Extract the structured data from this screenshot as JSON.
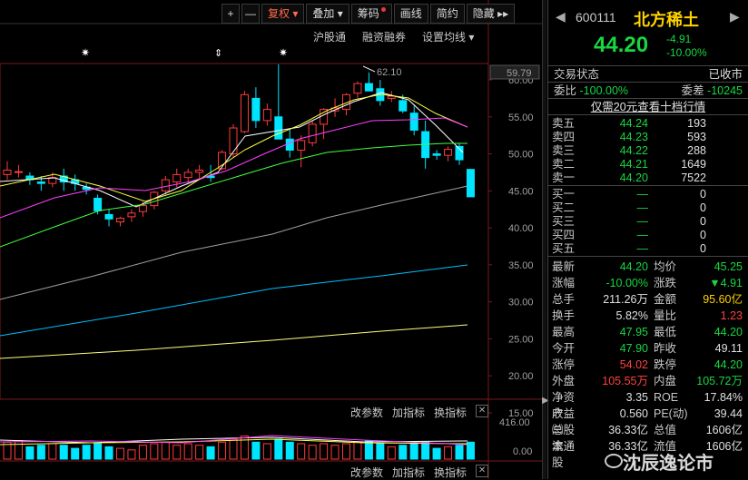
{
  "toolbar": {
    "plus": "+",
    "minus": "—",
    "restore": "复权",
    "overlay": "叠加",
    "chips": "筹码",
    "draw": "画线",
    "simple": "简约",
    "hide": "隐藏",
    "more": "▸▸"
  },
  "subbar": {
    "hk_connect": "沪股通",
    "margin": "融资融券",
    "ma_settings": "设置均线"
  },
  "chart": {
    "y_ticks": [
      "60.00",
      "55.00",
      "50.00",
      "45.00",
      "40.00",
      "35.00",
      "30.00",
      "25.00",
      "20.00",
      "15.00"
    ],
    "current_price_tag": "59.79",
    "high_marker": "62.10",
    "vol_ticks": [
      "416.00",
      "0.00"
    ],
    "colors": {
      "up": "#ff3b3b",
      "down": "#00e5ff",
      "ma5": "#ffffff",
      "ma10": "#ffff40",
      "ma20": "#ff40ff",
      "ma30": "#40ff40",
      "ma60": "#a0a0a0",
      "ma120": "#00c0ff",
      "ma250": "#ffff80"
    }
  },
  "indicator_bar": {
    "params": "改参数",
    "add": "加指标",
    "change": "换指标",
    "close": "✕"
  },
  "quote": {
    "code": "600111",
    "name": "北方稀土",
    "price": "44.20",
    "change": "-4.91",
    "change_pct": "-10.00%",
    "trade_status_label": "交易状态",
    "trade_status": "已收市",
    "ratio_label": "委比",
    "ratio": "-100.00%",
    "diff_label": "委差",
    "diff": "-10245",
    "promo": "仅需20元查看十档行情",
    "asks": [
      {
        "label": "卖五",
        "price": "44.24",
        "vol": "193"
      },
      {
        "label": "卖四",
        "price": "44.23",
        "vol": "593"
      },
      {
        "label": "卖三",
        "price": "44.22",
        "vol": "288"
      },
      {
        "label": "卖二",
        "price": "44.21",
        "vol": "1649"
      },
      {
        "label": "卖一",
        "price": "44.20",
        "vol": "7522"
      }
    ],
    "bids": [
      {
        "label": "买一",
        "price": "—",
        "vol": "0"
      },
      {
        "label": "买二",
        "price": "—",
        "vol": "0"
      },
      {
        "label": "买三",
        "price": "—",
        "vol": "0"
      },
      {
        "label": "买四",
        "price": "—",
        "vol": "0"
      },
      {
        "label": "买五",
        "price": "—",
        "vol": "0"
      }
    ],
    "stats": [
      {
        "l1": "最新",
        "v1": "44.20",
        "c1": "green",
        "l2": "均价",
        "v2": "45.25",
        "c2": "green"
      },
      {
        "l1": "涨幅",
        "v1": "-10.00%",
        "c1": "green",
        "l2": "涨跌",
        "v2": "▼4.91",
        "c2": "green"
      },
      {
        "l1": "总手",
        "v1": "211.26万",
        "c1": "white",
        "l2": "金额",
        "v2": "95.60亿",
        "c2": "yellow"
      },
      {
        "l1": "换手",
        "v1": "5.82%",
        "c1": "white",
        "l2": "量比",
        "v2": "1.23",
        "c2": "red"
      },
      {
        "l1": "最高",
        "v1": "47.95",
        "c1": "green",
        "l2": "最低",
        "v2": "44.20",
        "c2": "green"
      },
      {
        "l1": "今开",
        "v1": "47.90",
        "c1": "green",
        "l2": "昨收",
        "v2": "49.11",
        "c2": "white"
      },
      {
        "l1": "涨停",
        "v1": "54.02",
        "c1": "red",
        "l2": "跌停",
        "v2": "44.20",
        "c2": "green"
      },
      {
        "l1": "外盘",
        "v1": "105.55万",
        "c1": "red",
        "l2": "内盘",
        "v2": "105.72万",
        "c2": "green"
      },
      {
        "l1": "净资产",
        "v1": "3.35",
        "c1": "white",
        "l2": "ROE",
        "v2": "17.84%",
        "c2": "white"
      },
      {
        "l1": "收益㈢",
        "v1": "0.560",
        "c1": "white",
        "l2": "PE(动)",
        "v2": "39.44",
        "c2": "white"
      },
      {
        "l1": "总股本",
        "v1": "36.33亿",
        "c1": "white",
        "l2": "总值",
        "v2": "1606亿",
        "c2": "white"
      },
      {
        "l1": "流通股",
        "v1": "36.33亿",
        "c1": "white",
        "l2": "流值",
        "v2": "1606亿",
        "c2": "white"
      }
    ]
  },
  "watermark": "沈辰逸论市"
}
